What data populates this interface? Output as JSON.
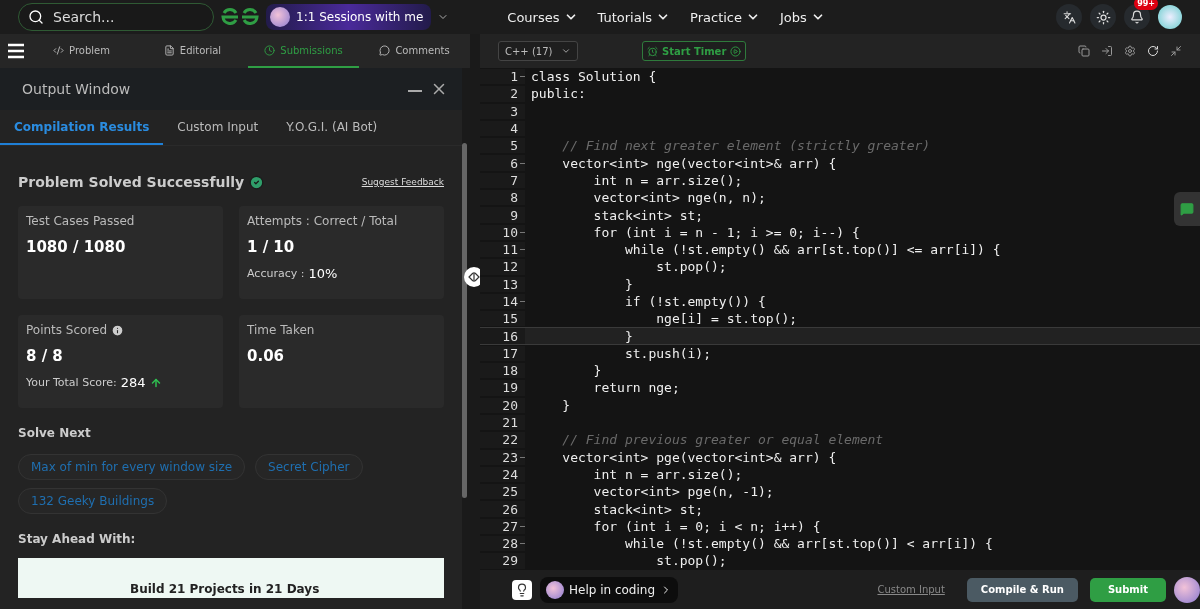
{
  "nav": {
    "search": {
      "placeholder": "Search..."
    },
    "sessions": "1:1 Sessions with me",
    "menus": [
      "Courses",
      "Tutorials",
      "Practice",
      "Jobs"
    ],
    "notification_badge": "99+"
  },
  "problem_tabs": [
    {
      "label": "Problem",
      "selected": false
    },
    {
      "label": "Editorial",
      "selected": false
    },
    {
      "label": "Submissions",
      "selected": true
    },
    {
      "label": "Comments",
      "selected": false
    }
  ],
  "output_window": {
    "title": "Output Window",
    "tabs": [
      {
        "label": "Compilation Results",
        "selected": true
      },
      {
        "label": "Custom Input",
        "selected": false
      },
      {
        "label": "Y.O.G.I. (AI Bot)",
        "selected": false
      }
    ],
    "status": "Problem Solved Successfully",
    "feedback_link": "Suggest Feedback",
    "cards": [
      {
        "label": "Test Cases Passed",
        "value": "1080 / 1080"
      },
      {
        "label": "Attempts : Correct / Total",
        "value": "1 / 10",
        "note_label": "Accuracy :",
        "note_value": "10%"
      },
      {
        "label": "Points Scored",
        "value": "8 / 8",
        "info": true,
        "note_label": "Your Total Score:",
        "note_value": "284",
        "trend_up": true
      },
      {
        "label": "Time Taken",
        "value": "0.06"
      }
    ],
    "solve_next": {
      "heading": "Solve Next",
      "problems": [
        "Max of min for every window size",
        "Secret Cipher",
        "132 Geeky Buildings"
      ]
    },
    "stay_ahead": {
      "heading": "Stay Ahead With:",
      "banner": "Build 21 Projects in 21 Days"
    }
  },
  "editor": {
    "language": "C++ (17)",
    "timer": "Start Timer",
    "lines": [
      {
        "n": "1",
        "text": "class Solution {",
        "kind": "code",
        "fold": true,
        "current": false
      },
      {
        "n": "2",
        "text": "public:",
        "kind": "code",
        "fold": false,
        "current": false
      },
      {
        "n": "3",
        "fold": false,
        "current": false
      },
      {
        "n": "4",
        "fold": false,
        "current": false
      },
      {
        "n": "5",
        "text": "    // Find next greater element (strictly greater)",
        "kind": "comment",
        "fold": false,
        "current": false
      },
      {
        "n": "6",
        "text": "    vector<int> nge(vector<int>& arr) {",
        "kind": "code",
        "fold": true,
        "current": false
      },
      {
        "n": "7",
        "text": "        int n = arr.size();",
        "kind": "code",
        "fold": false,
        "current": false
      },
      {
        "n": "8",
        "text": "        vector<int> nge(n, n);",
        "kind": "code",
        "fold": false,
        "current": false
      },
      {
        "n": "9",
        "text": "        stack<int> st;",
        "kind": "code",
        "fold": false,
        "current": false
      },
      {
        "n": "10",
        "text": "        for (int i = n - 1; i >= 0; i--) {",
        "kind": "code",
        "fold": true,
        "current": false
      },
      {
        "n": "11",
        "text": "            while (!st.empty() && arr[st.top()] <= arr[i]) {",
        "kind": "code",
        "fold": true,
        "current": false
      },
      {
        "n": "12",
        "text": "                st.pop();",
        "kind": "code",
        "fold": false,
        "current": false
      },
      {
        "n": "13",
        "text": "            }",
        "kind": "code",
        "fold": false,
        "current": false
      },
      {
        "n": "14",
        "text": "            if (!st.empty()) {",
        "kind": "code",
        "fold": true,
        "current": false
      },
      {
        "n": "15",
        "text": "                nge[i] = st.top();",
        "kind": "code",
        "fold": false,
        "current": false
      },
      {
        "n": "16",
        "text": "            }",
        "kind": "code",
        "fold": false,
        "current": true
      },
      {
        "n": "17",
        "text": "            st.push(i);",
        "kind": "code",
        "fold": false,
        "current": false
      },
      {
        "n": "18",
        "text": "        }",
        "kind": "code",
        "fold": false,
        "current": false
      },
      {
        "n": "19",
        "text": "        return nge;",
        "kind": "code",
        "fold": false,
        "current": false
      },
      {
        "n": "20",
        "text": "    }",
        "kind": "code",
        "fold": false,
        "current": false
      },
      {
        "n": "21",
        "fold": false,
        "current": false
      },
      {
        "n": "22",
        "text": "    // Find previous greater or equal element",
        "kind": "comment",
        "fold": false,
        "current": false
      },
      {
        "n": "23",
        "text": "    vector<int> pge(vector<int>& arr) {",
        "kind": "code",
        "fold": true,
        "current": false
      },
      {
        "n": "24",
        "text": "        int n = arr.size();",
        "kind": "code",
        "fold": false,
        "current": false
      },
      {
        "n": "25",
        "text": "        vector<int> pge(n, -1);",
        "kind": "code",
        "fold": false,
        "current": false
      },
      {
        "n": "26",
        "text": "        stack<int> st;",
        "kind": "code",
        "fold": false,
        "current": false
      },
      {
        "n": "27",
        "text": "        for (int i = 0; i < n; i++) {",
        "kind": "code",
        "fold": true,
        "current": false
      },
      {
        "n": "28",
        "text": "            while (!st.empty() && arr[st.top()] < arr[i]) {",
        "kind": "code",
        "fold": true,
        "current": false
      },
      {
        "n": "29",
        "text": "                st.pop();",
        "kind": "code",
        "fold": false,
        "current": false
      }
    ],
    "help": "Help in coding",
    "custom_input": "Custom Input",
    "compile": "Compile & Run",
    "submit": "Submit"
  }
}
